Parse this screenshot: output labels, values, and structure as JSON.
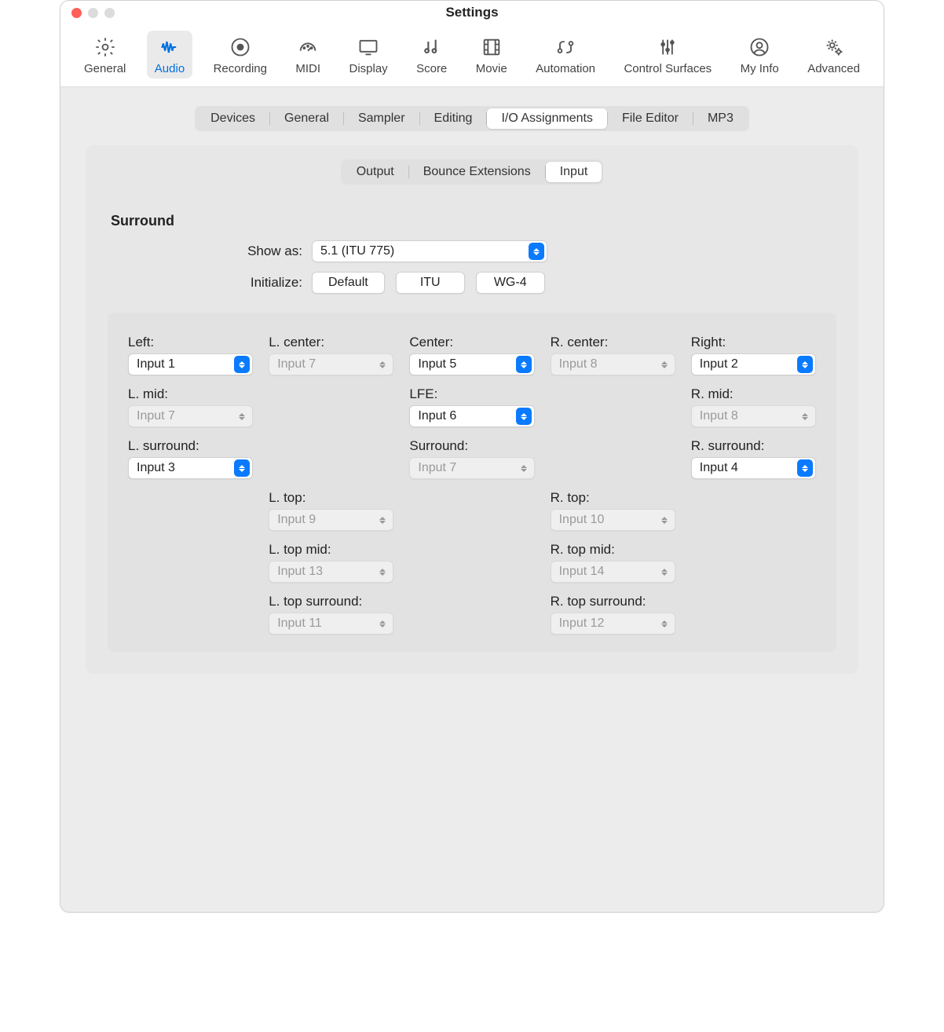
{
  "window": {
    "title": "Settings"
  },
  "toolbar": {
    "items": [
      "General",
      "Audio",
      "Recording",
      "MIDI",
      "Display",
      "Score",
      "Movie",
      "Automation",
      "Control Surfaces",
      "My Info",
      "Advanced"
    ],
    "active": 1
  },
  "tabs1": {
    "items": [
      "Devices",
      "General",
      "Sampler",
      "Editing",
      "I/O Assignments",
      "File Editor",
      "MP3"
    ],
    "active": 4
  },
  "tabs2": {
    "items": [
      "Output",
      "Bounce Extensions",
      "Input"
    ],
    "active": 2
  },
  "surround": {
    "title": "Surround",
    "show_as_label": "Show as:",
    "show_as_value": "5.1 (ITU 775)",
    "initialize_label": "Initialize:",
    "buttons": [
      "Default",
      "ITU",
      "WG-4"
    ]
  },
  "channels": [
    [
      {
        "label": "Left:",
        "value": "Input 1",
        "enabled": true
      },
      {
        "label": "L. center:",
        "value": "Input 7",
        "enabled": false
      },
      {
        "label": "Center:",
        "value": "Input 5",
        "enabled": true
      },
      {
        "label": "R. center:",
        "value": "Input 8",
        "enabled": false
      },
      {
        "label": "Right:",
        "value": "Input 2",
        "enabled": true
      }
    ],
    [
      {
        "label": "L. mid:",
        "value": "Input 7",
        "enabled": false
      },
      null,
      {
        "label": "LFE:",
        "value": "Input 6",
        "enabled": true
      },
      null,
      {
        "label": "R. mid:",
        "value": "Input 8",
        "enabled": false
      }
    ],
    [
      {
        "label": "L. surround:",
        "value": "Input 3",
        "enabled": true
      },
      null,
      {
        "label": "Surround:",
        "value": "Input 7",
        "enabled": false
      },
      null,
      {
        "label": "R. surround:",
        "value": "Input 4",
        "enabled": true
      }
    ],
    [
      null,
      {
        "label": "L. top:",
        "value": "Input 9",
        "enabled": false
      },
      null,
      {
        "label": "R. top:",
        "value": "Input 10",
        "enabled": false
      },
      null
    ],
    [
      null,
      {
        "label": "L. top mid:",
        "value": "Input 13",
        "enabled": false
      },
      null,
      {
        "label": "R. top mid:",
        "value": "Input 14",
        "enabled": false
      },
      null
    ],
    [
      null,
      {
        "label": "L. top surround:",
        "value": "Input 11",
        "enabled": false
      },
      null,
      {
        "label": "R. top surround:",
        "value": "Input 12",
        "enabled": false
      },
      null
    ]
  ]
}
